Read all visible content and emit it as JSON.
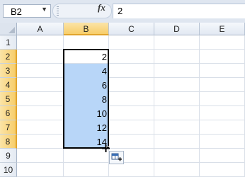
{
  "formula_bar": {
    "name_box": "B2",
    "fx_label": "fx",
    "formula": "2",
    "name_box_arrow": "▼"
  },
  "columns": [
    "A",
    "B",
    "C",
    "D",
    "E"
  ],
  "rows": [
    "1",
    "2",
    "3",
    "4",
    "5",
    "6",
    "7",
    "8",
    "9",
    "10"
  ],
  "cells": {
    "B2": "2",
    "B3": "4",
    "B4": "6",
    "B5": "8",
    "B6": "10",
    "B7": "12",
    "B8": "14"
  },
  "selection": {
    "active_cell": "B2",
    "range": "B2:B8"
  },
  "colors": {
    "selection_fill": "#b8d6f8",
    "header_selected": "#f7cd6a",
    "grid_line": "#d9dfe8"
  },
  "icons": {
    "autofill_options": "autofill-options-icon",
    "fill_cursor": "plus-cursor-icon"
  }
}
